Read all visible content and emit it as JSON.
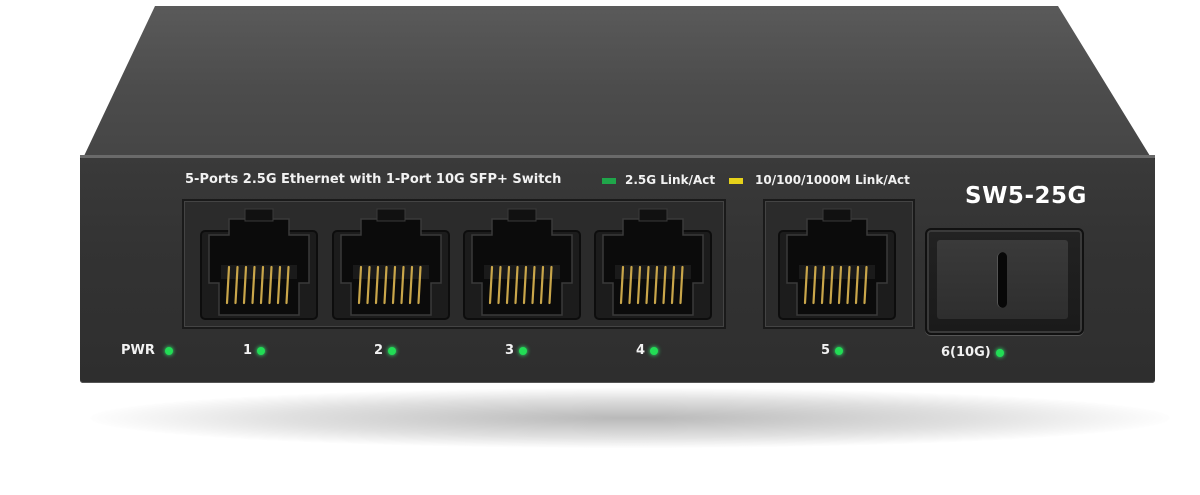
{
  "device": {
    "title": "5-Ports 2.5G Ethernet with 1-Port 10G SFP+ Switch",
    "model": "SW5-25G",
    "colors": {
      "body": "#333333",
      "top": "#4d4d4d",
      "led": "#22dd55",
      "legend_green": "#1fa64a",
      "legend_yellow": "#e6d21a"
    }
  },
  "legend": {
    "green_label": "2.5G Link/Act",
    "yellow_label": "10/100/1000M Link/Act"
  },
  "indicators": {
    "pwr": "PWR",
    "ports": [
      "1",
      "2",
      "3",
      "4",
      "5",
      "6(10G)"
    ]
  }
}
